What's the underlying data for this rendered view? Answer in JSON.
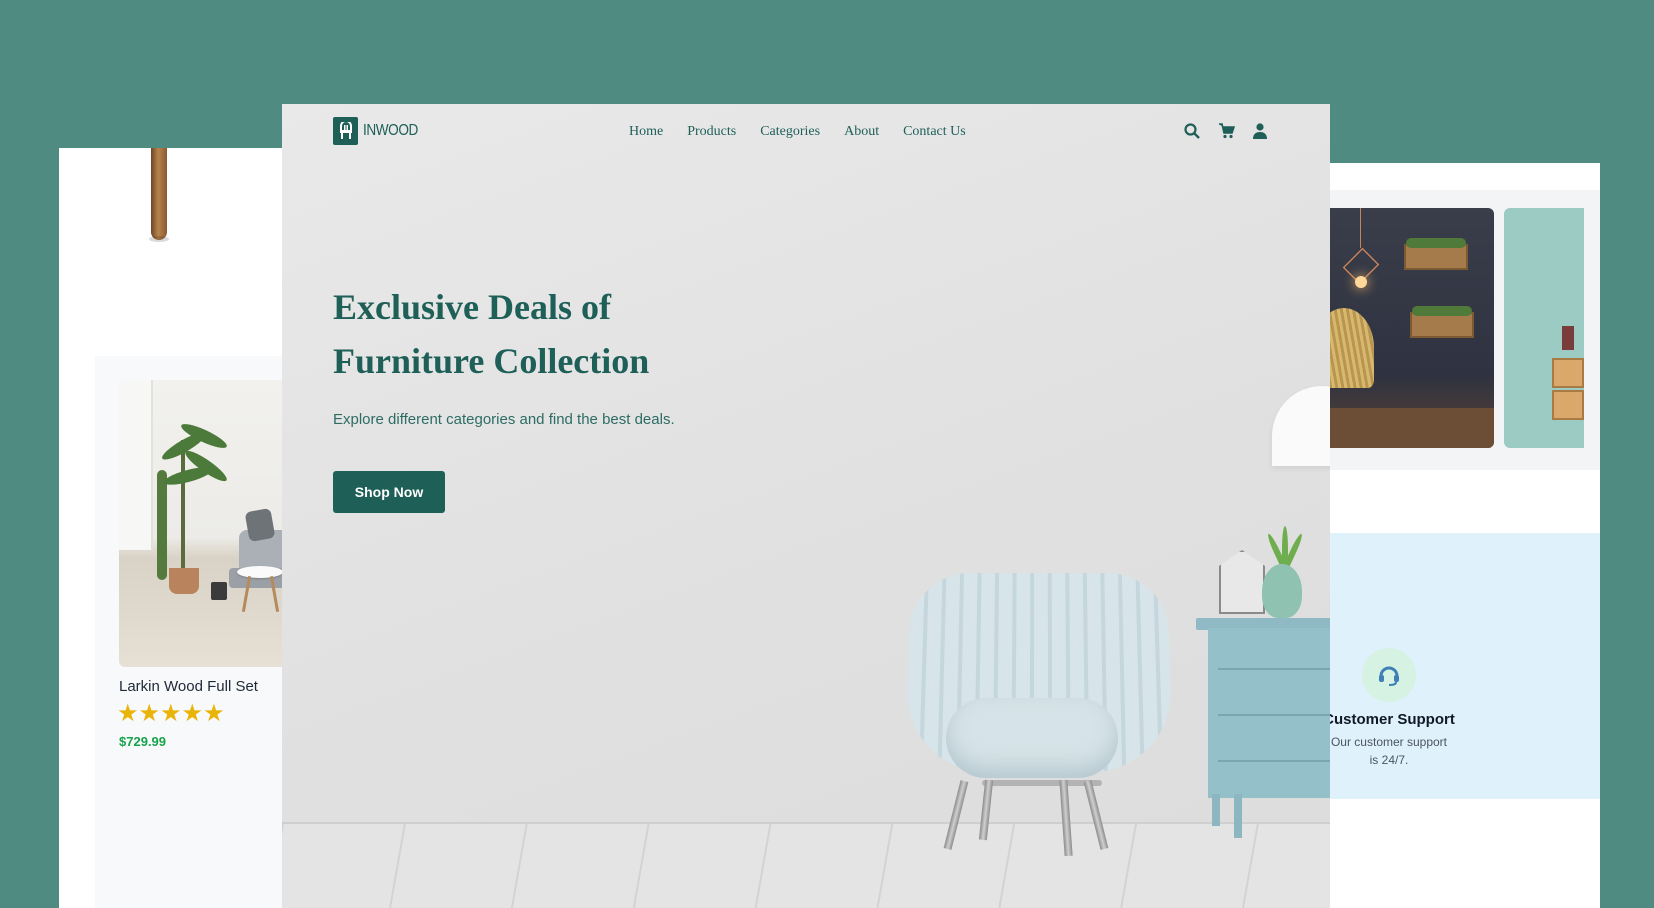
{
  "nav": {
    "logo_text": "INWOOD",
    "links": [
      "Home",
      "Products",
      "Categories",
      "About",
      "Contact Us"
    ]
  },
  "hero": {
    "headline": "Exclusive Deals of Furniture Collection",
    "subtext": "Explore different categories and find the best deals.",
    "cta": "Shop Now"
  },
  "left_card": {
    "name": "Larkin Wood Full Set",
    "stars": "★★★★★",
    "price": "$729.99"
  },
  "support": {
    "title": "Customer Support",
    "text": "Our customer support is 24/7."
  },
  "colors": {
    "brand": "#1e5f58",
    "background": "#4f8b80",
    "price": "#16a34a",
    "stars": "#eab308",
    "support_bg": "#dff1fb"
  },
  "icons": [
    "chair-logo-icon",
    "search-icon",
    "cart-icon",
    "user-icon",
    "support-icon"
  ]
}
